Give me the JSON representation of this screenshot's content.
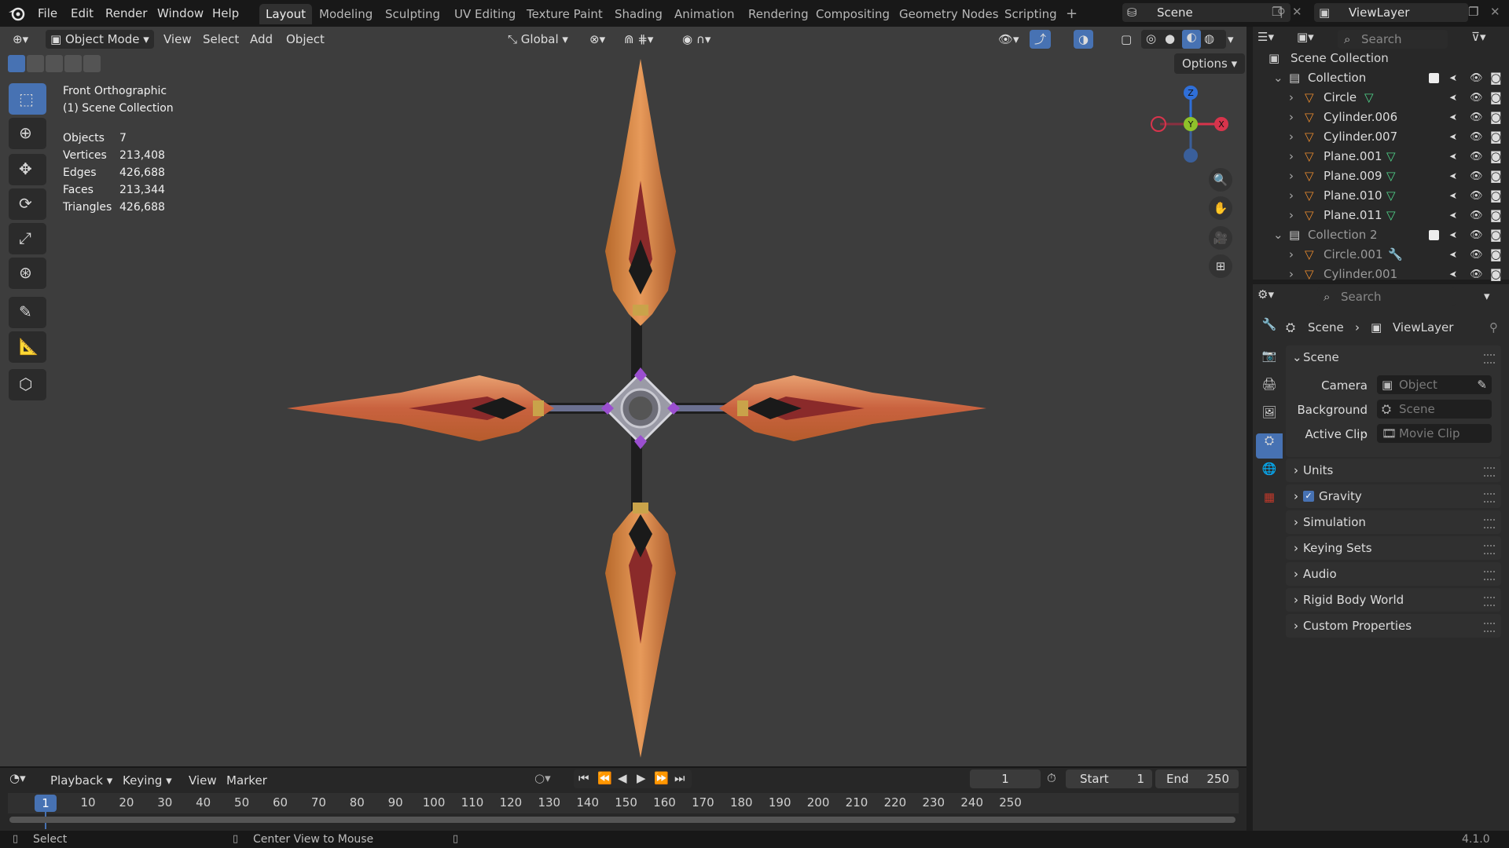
{
  "menu": [
    "File",
    "Edit",
    "Render",
    "Window",
    "Help"
  ],
  "workspaces": [
    {
      "label": "Layout",
      "active": true
    },
    {
      "label": "Modeling"
    },
    {
      "label": "Sculpting"
    },
    {
      "label": "UV Editing"
    },
    {
      "label": "Texture Paint"
    },
    {
      "label": "Shading"
    },
    {
      "label": "Animation"
    },
    {
      "label": "Rendering"
    },
    {
      "label": "Compositing"
    },
    {
      "label": "Geometry Nodes"
    },
    {
      "label": "Scripting"
    }
  ],
  "scene_name": "Scene",
  "viewlayer_name": "ViewLayer",
  "viewport_header": {
    "mode": "Object Mode",
    "view": "View",
    "select": "Select",
    "add": "Add",
    "object": "Object",
    "transform": "Global",
    "options": "Options"
  },
  "viewport_info": {
    "view_name": "Front Orthographic",
    "collection": "(1) Scene Collection"
  },
  "stats": [
    {
      "label": "Objects",
      "value": "7"
    },
    {
      "label": "Vertices",
      "value": "213,408"
    },
    {
      "label": "Edges",
      "value": "426,688"
    },
    {
      "label": "Faces",
      "value": "213,344"
    },
    {
      "label": "Triangles",
      "value": "426,688"
    }
  ],
  "gizmo": {
    "z": "Z",
    "y": "Y",
    "x": "X"
  },
  "outliner": {
    "search_placeholder": "Search",
    "root": "Scene Collection",
    "rows": [
      {
        "label": "Collection",
        "type": "collection",
        "indent": 0
      },
      {
        "label": "Circle",
        "type": "object",
        "indent": 1
      },
      {
        "label": "Cylinder.006",
        "type": "object",
        "indent": 1
      },
      {
        "label": "Cylinder.007",
        "type": "object",
        "indent": 1
      },
      {
        "label": "Plane.001",
        "type": "object",
        "indent": 1
      },
      {
        "label": "Plane.009",
        "type": "object",
        "indent": 1
      },
      {
        "label": "Plane.010",
        "type": "object",
        "indent": 1
      },
      {
        "label": "Plane.011",
        "type": "object",
        "indent": 1
      },
      {
        "label": "Collection 2",
        "type": "collection",
        "indent": 0
      },
      {
        "label": "Circle.001",
        "type": "object",
        "indent": 1
      },
      {
        "label": "Cylinder.001",
        "type": "object",
        "indent": 1
      }
    ]
  },
  "properties": {
    "search_placeholder": "Search",
    "breadcrumb": [
      "Scene",
      "ViewLayer"
    ],
    "scene_section": "Scene",
    "fields": [
      {
        "label": "Camera",
        "placeholder": "Object"
      },
      {
        "label": "Background ...",
        "placeholder": "Scene"
      },
      {
        "label": "Active Clip",
        "placeholder": "Movie Clip"
      }
    ],
    "panels": [
      "Units",
      "Gravity",
      "Simulation",
      "Keying Sets",
      "Audio",
      "Rigid Body World",
      "Custom Properties"
    ]
  },
  "timeline": {
    "menus": [
      "Playback",
      "Keying",
      "View",
      "Marker"
    ],
    "current_frame": "1",
    "start_label": "Start",
    "start": "1",
    "end_label": "End",
    "end": "250",
    "ticks": [
      "10",
      "20",
      "30",
      "40",
      "50",
      "60",
      "70",
      "80",
      "90",
      "100",
      "110",
      "120",
      "130",
      "140",
      "150",
      "160",
      "170",
      "180",
      "190",
      "200",
      "210",
      "220",
      "230",
      "240",
      "250"
    ]
  },
  "statusbar": {
    "select": "Select",
    "center": "Center View to Mouse",
    "version": "4.1.0"
  }
}
